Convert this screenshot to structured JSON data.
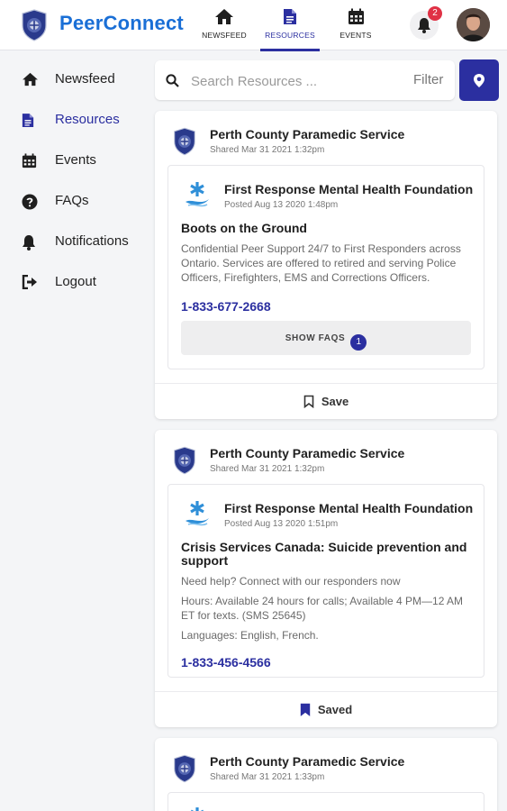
{
  "app": {
    "brand": "PeerConnect"
  },
  "nav_tabs": [
    {
      "label": "NEWSFEED",
      "icon": "home-icon",
      "active": false
    },
    {
      "label": "RESOURCES",
      "icon": "document-icon",
      "active": true
    },
    {
      "label": "EVENTS",
      "icon": "calendar-icon",
      "active": false
    }
  ],
  "notifications": {
    "count": "2"
  },
  "sidebar": {
    "items": [
      {
        "label": "Newsfeed",
        "icon": "home-icon"
      },
      {
        "label": "Resources",
        "icon": "document-icon",
        "active": true
      },
      {
        "label": "Events",
        "icon": "calendar-icon"
      },
      {
        "label": "FAQs",
        "icon": "question-circle-icon"
      },
      {
        "label": "Notifications",
        "icon": "bell-icon"
      },
      {
        "label": "Logout",
        "icon": "logout-icon"
      }
    ]
  },
  "search": {
    "placeholder": "Search Resources ...",
    "filter_label": "Filter"
  },
  "colors": {
    "accent": "#2b2fa0",
    "brand": "#1a6fd6",
    "badge": "#e03145"
  },
  "posts": [
    {
      "org": "Perth County Paramedic Service",
      "shared": "Shared Mar 31 2021 1:32pm",
      "foundation": "First Response Mental Health Foundation",
      "posted": "Posted Aug 13 2020 1:48pm",
      "title": "Boots on the Ground",
      "description": "Confidential Peer Support 24/7 to First Responders across Ontario. Services are offered to retired and serving Police Officers, Firefighters, EMS and Corrections Officers.",
      "phone": "1-833-677-2668",
      "faq_label": "SHOW FAQS",
      "faq_count": "1",
      "save_label": "Save",
      "saved": false
    },
    {
      "org": "Perth County Paramedic Service",
      "shared": "Shared Mar 31 2021 1:32pm",
      "foundation": "First Response Mental Health Foundation",
      "posted": "Posted Aug 13 2020 1:51pm",
      "title": "Crisis Services Canada: Suicide prevention and support",
      "line1": "Need help? Connect with our responders now",
      "line2": "Hours: Available 24 hours for calls; Available 4 PM—12 AM ET for texts. (SMS 25645)",
      "line3": "Languages: English, French.",
      "phone": "1-833-456-4566",
      "save_label": "Saved",
      "saved": true
    },
    {
      "org": "Perth County Paramedic Service",
      "shared": "Shared Mar 31 2021 1:33pm"
    }
  ]
}
